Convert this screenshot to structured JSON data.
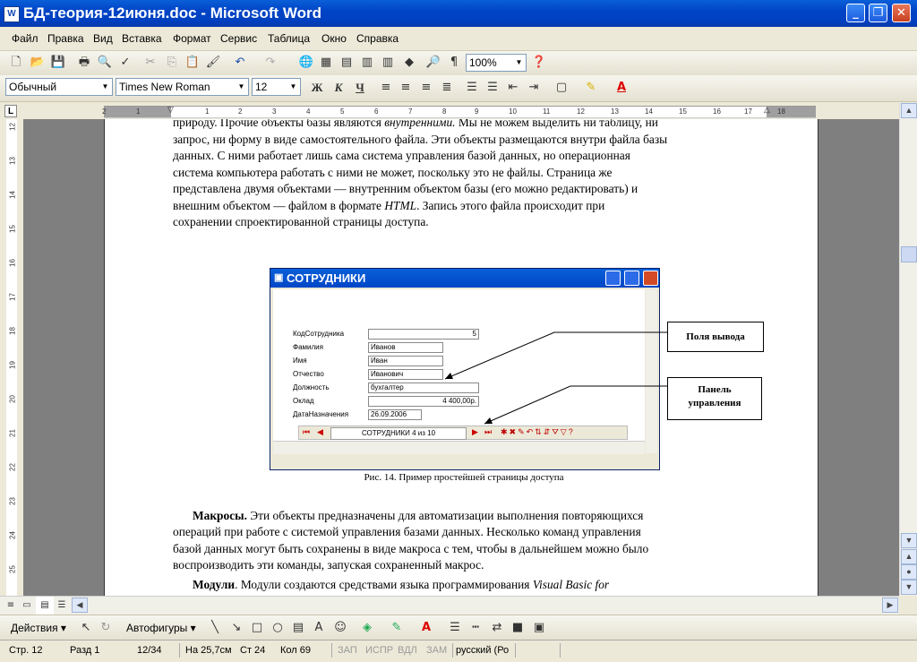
{
  "window": {
    "title": "БД-теория-12июня.doc - Microsoft Word",
    "app_icon": "W"
  },
  "menu": [
    "Файл",
    "Правка",
    "Вид",
    "Вставка",
    "Формат",
    "Сервис",
    "Таблица",
    "Окно",
    "Справка"
  ],
  "standard_toolbar": {
    "zoom": "100%"
  },
  "format_toolbar": {
    "style": "Обычный",
    "font": "Times New Roman",
    "size": "12",
    "bold": "Ж",
    "italic": "К",
    "underline": "Ч"
  },
  "ruler": {
    "numbers": [
      "2",
      "1",
      "1",
      "2",
      "3",
      "4",
      "5",
      "6",
      "7",
      "8",
      "9",
      "10",
      "11",
      "12",
      "13",
      "14",
      "15",
      "16",
      "17",
      "18"
    ],
    "vnumbers": [
      "12",
      "13",
      "14",
      "15",
      "16",
      "17",
      "18",
      "19",
      "20",
      "21",
      "22",
      "23",
      "24",
      "25"
    ],
    "corner": "L"
  },
  "document": {
    "para1_lines": [
      "природу. Прочие объекты базы являются ",
      "запрос, ни форму в виде самостоятельного файла. Эти объекты размещаются внутри файла базы",
      "данных. С ними работает лишь сама система управления базой данных, но операционная",
      "система компьютера работать с ними не может, поскольку это не файлы. Страница же",
      "представлена двумя объектами — внутренним объектом базы (его можно редактировать) и",
      "внешним объектом — файлом в формате ",
      "сохранении спроектированной страницы доступа."
    ],
    "para1_italic_1": "внутренними.",
    "para1_tail_1": " Мы не можем выделить ни таблицу, ни",
    "para1_italic_2": "HTML",
    "para1_tail_2": ". Запись этого файла происходит при",
    "figure": {
      "title": "СОТРУДНИКИ",
      "fields": [
        {
          "label": "КодСотрудника",
          "value": "5"
        },
        {
          "label": "Фамилия",
          "value": "Иванов"
        },
        {
          "label": "Имя",
          "value": "Иван"
        },
        {
          "label": "Отчество",
          "value": "Иванович"
        },
        {
          "label": "Должность",
          "value": "бухгалтер"
        },
        {
          "label": "Оклад",
          "value": "4 400,00р."
        },
        {
          "label": "ДатаНазначения",
          "value": "26.09.2006"
        }
      ],
      "nav_record": "СОТРУДНИКИ 4 из 10",
      "callout1": "Поля вывода",
      "callout2_line1": "Панель",
      "callout2_line2": "управления",
      "caption": "Рис. 14. Пример простейшей страницы доступа"
    },
    "macros_heading": "Макросы.",
    "macros_lines": [
      " Эти объекты предназначены для автоматизации выполнения повторяющихся",
      "операций при работе с системой управления базами данных. Несколько команд управления",
      "базой данных могут быть сохранены в виде макроса с тем, чтобы в дальнейшем можно было",
      "воспроизводить эти команды, запуская сохраненный макрос."
    ],
    "modules_heading": "Модули",
    "modules_line": ".  Модули создаются средствами языка программирования ",
    "modules_italic": "Visual Basic for"
  },
  "drawing_toolbar": {
    "actions": "Действия",
    "autoshapes": "Автофигуры"
  },
  "status": {
    "page": "Стр.  12",
    "section": "Разд  1",
    "pages": "12/34",
    "at": "На 25,7см",
    "line": "Ст  24",
    "col": "Кол  69",
    "rec": "ЗАП",
    "trk": "ИСПР",
    "ext": "ВДЛ",
    "ovr": "ЗАМ",
    "lang": "русский (Ро"
  }
}
